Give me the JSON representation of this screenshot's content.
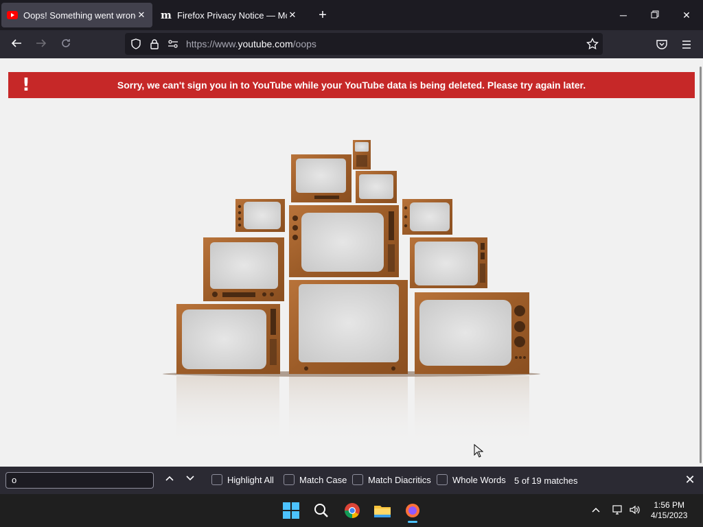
{
  "tabs": [
    {
      "title": "Oops! Something went wrong.",
      "active": true,
      "favicon": "youtube-favicon"
    },
    {
      "title": "Firefox Privacy Notice — Mozilla",
      "active": false,
      "favicon": "mozilla-favicon"
    }
  ],
  "window_controls": {
    "minimize": "minimize-icon",
    "restore": "restore-icon",
    "close": "close-icon"
  },
  "navbar": {
    "url_scheme": "https://www.",
    "url_host": "youtube.com",
    "url_path": "/oops"
  },
  "page": {
    "banner_icon": "!",
    "banner_text": "Sorry, we can't sign you in to YouTube while your YouTube data is being deleted. Please try again later.",
    "illustration": "stacked-retro-televisions",
    "colors": {
      "banner": "#c62828",
      "wood": "#a0622d",
      "screen": "#e2e2e2"
    }
  },
  "findbar": {
    "query": "o",
    "highlight_all": "Highlight All",
    "match_case": "Match Case",
    "match_diacritics": "Match Diacritics",
    "whole_words": "Whole Words",
    "status": "5 of 19 matches"
  },
  "taskbar": {
    "apps": [
      "windows-start-icon",
      "search-icon",
      "chrome-icon",
      "file-explorer-icon",
      "firefox-icon"
    ],
    "time": "1:56 PM",
    "date": "4/15/2023"
  }
}
